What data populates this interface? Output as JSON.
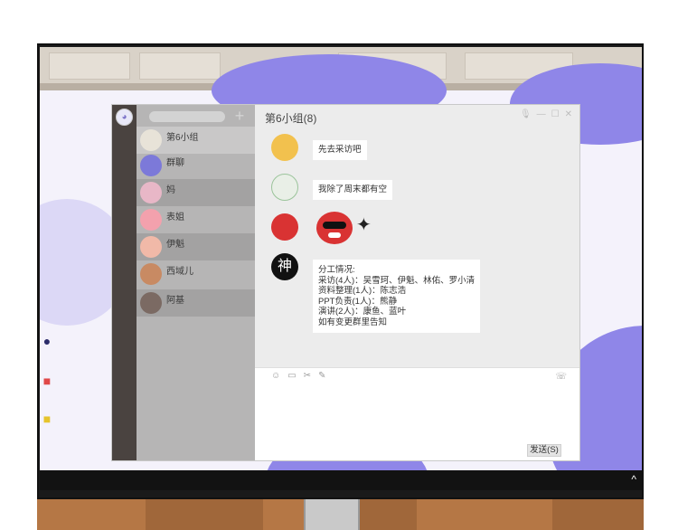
{
  "chat": {
    "title": "第6小组(8)",
    "window_controls": [
      "🎙",
      "—",
      "☐",
      "✕"
    ]
  },
  "contacts": [
    {
      "name": "第6小组",
      "color": "#e8e3d8"
    },
    {
      "name": "群聊",
      "color": "#7c79d9"
    },
    {
      "name": "妈",
      "color": "#e8b7c7"
    },
    {
      "name": "表姐",
      "color": "#f3a1ad"
    },
    {
      "name": "伊魁",
      "color": "#f1b9a8"
    },
    {
      "name": "西域儿",
      "color": "#c88a63"
    },
    {
      "name": "阿基",
      "color": "#7b6a63"
    }
  ],
  "messages": [
    {
      "avatar_color": "#f2c14e",
      "lines": [
        "先去采访吧"
      ]
    },
    {
      "avatar_color": "#e9efe7",
      "lines": [
        "我除了周末都有空"
      ]
    },
    {
      "avatar_color": "#d93333",
      "sticker": true,
      "lines": []
    },
    {
      "avatar_color": "#111111",
      "avatar_text": "神",
      "lines": [
        "分工情况:",
        "采访(4人)：吴雪珂、伊魁、林佑、罗小清",
        "资料整理(1人)：陈志浩",
        "PPT负责(1人)：熊静",
        "演讲(2人)：康鱼、蓝叶",
        "如有变更群里告知"
      ]
    }
  ],
  "composer": {
    "toolbar_icons": [
      "☺",
      "▭",
      "✂",
      "✎"
    ],
    "send_label": "发送(S)"
  },
  "taskbar": {
    "tray": "^"
  }
}
